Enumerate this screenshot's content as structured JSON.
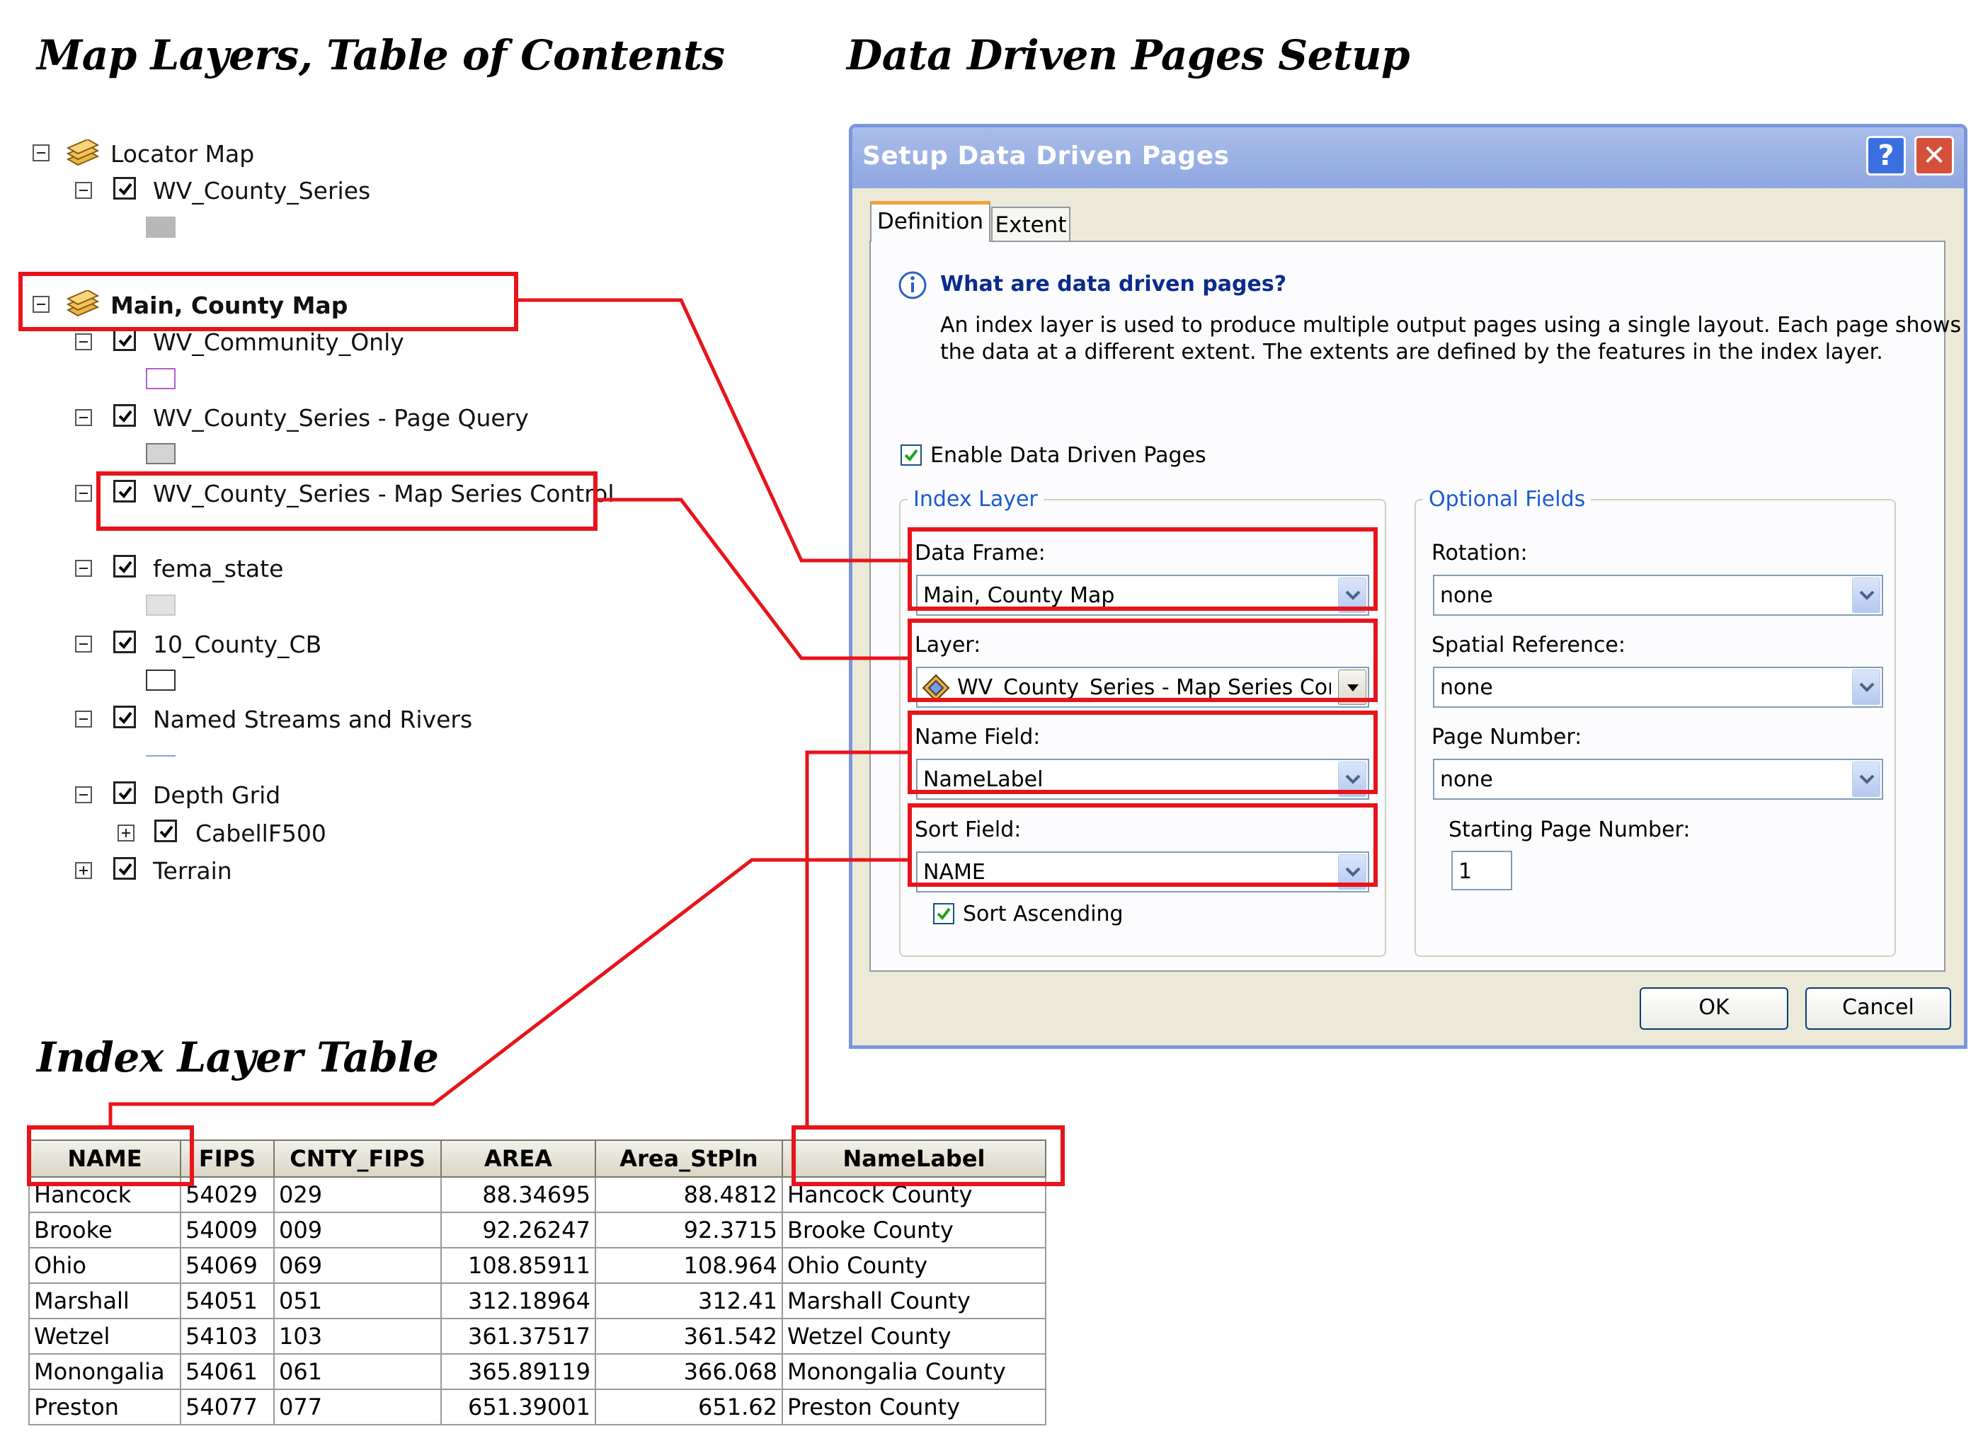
{
  "headings": {
    "toc": "Map Layers, Table of Contents",
    "ddp": "Data Driven Pages Setup",
    "index": "Index Layer Table"
  },
  "toc": {
    "locator_map": "Locator Map",
    "wv_county_series": "WV_County_Series",
    "main_county_map": "Main, County Map",
    "wv_community_only": "WV_Community_Only",
    "page_query": "WV_County_Series - Page Query",
    "map_series_control": "WV_County_Series - Map Series Control",
    "fema_state": "fema_state",
    "county_cb": "10_County_CB",
    "streams": "Named Streams and Rivers",
    "depth_grid": "Depth Grid",
    "cabell": "CabellF500",
    "terrain": "Terrain"
  },
  "dialog": {
    "title": "Setup Data Driven Pages",
    "help_label": "?",
    "close_label": "✕",
    "tabs": [
      "Definition",
      "Extent"
    ],
    "info_heading": "What are data driven pages?",
    "info_line1": "An index layer is used to produce multiple output pages using a single layout.   Each page shows",
    "info_line2": "the data at a different extent.  The extents are defined by the features in the index layer.",
    "enable_label": "Enable Data Driven Pages",
    "index_layer_group": "Index Layer",
    "data_frame_label": "Data Frame:",
    "data_frame_value": "Main, County Map",
    "layer_label": "Layer:",
    "layer_value": "WV_County_Series - Map Series Contr",
    "name_field_label": "Name Field:",
    "name_field_value": "NameLabel",
    "sort_field_label": "Sort Field:",
    "sort_field_value": "NAME",
    "sort_ascending_label": "Sort Ascending",
    "optional_group": "Optional Fields",
    "rotation_label": "Rotation:",
    "rotation_value": "none",
    "spatial_ref_label": "Spatial Reference:",
    "spatial_ref_value": "none",
    "page_number_label": "Page Number:",
    "page_number_value": "none",
    "starting_page_label": "Starting Page Number:",
    "starting_page_value": "1",
    "ok_label": "OK",
    "cancel_label": "Cancel"
  },
  "table": {
    "columns": [
      "NAME",
      "FIPS",
      "CNTY_FIPS",
      "AREA",
      "Area_StPln",
      "NameLabel"
    ],
    "rows": [
      [
        "Hancock",
        "54029",
        "029",
        "88.34695",
        "88.4812",
        "Hancock County"
      ],
      [
        "Brooke",
        "54009",
        "009",
        "92.26247",
        "92.3715",
        "Brooke County"
      ],
      [
        "Ohio",
        "54069",
        "069",
        "108.85911",
        "108.964",
        "Ohio County"
      ],
      [
        "Marshall",
        "54051",
        "051",
        "312.18964",
        "312.41",
        "Marshall County"
      ],
      [
        "Wetzel",
        "54103",
        "103",
        "361.37517",
        "361.542",
        "Wetzel County"
      ],
      [
        "Monongalia",
        "54061",
        "061",
        "365.89119",
        "366.068",
        "Monongalia County"
      ],
      [
        "Preston",
        "54077",
        "077",
        "651.39001",
        "651.62",
        "Preston County"
      ]
    ]
  },
  "colors": {
    "highlight": "#e8141b",
    "dialog_title_bar": "#8ea7e0",
    "group_title": "#1a5bd1",
    "info_heading": "#0a2c8c"
  }
}
